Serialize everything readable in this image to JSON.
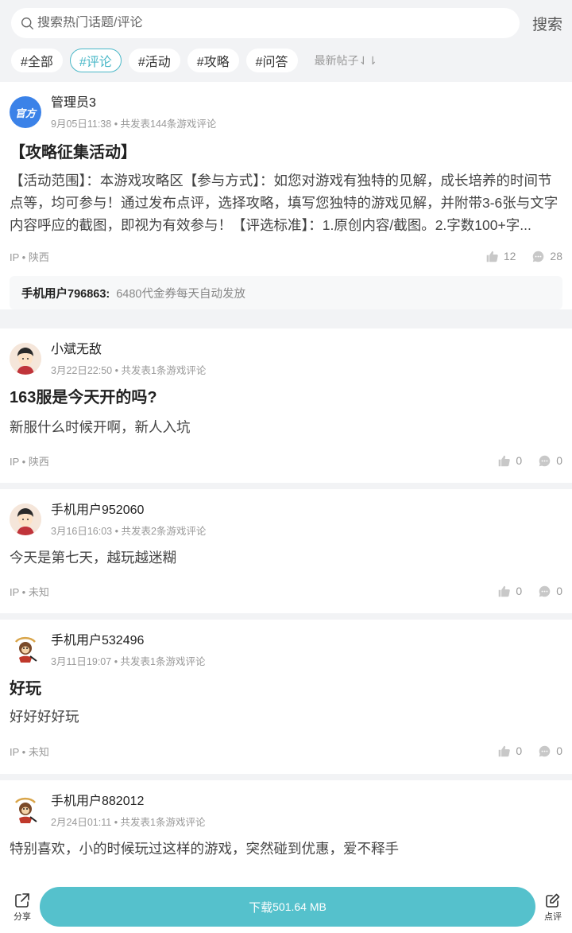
{
  "search": {
    "placeholder": "搜索热门话题/评论",
    "button": "搜索"
  },
  "tabs": [
    {
      "label": "#全部",
      "active": false
    },
    {
      "label": "#评论",
      "active": true
    },
    {
      "label": "#活动",
      "active": false
    },
    {
      "label": "#攻略",
      "active": false
    },
    {
      "label": "#问答",
      "active": false
    }
  ],
  "sort_label": "最新帖子⇃⇂",
  "posts": [
    {
      "user": "管理员3",
      "avatar_text": "官方",
      "time": "9月05日11:38",
      "count_text": "共发表144条游戏评论",
      "title": "【攻略征集活动】",
      "body": "【活动范围】：本游戏攻略区【参与方式】：如您对游戏有独特的见解，成长培养的时间节点等，均可参与！通过发布点评，选择攻略，填写您独特的游戏见解，并附带3-6张与文字内容呼应的截图，即视为有效参与！【评选标准】：1.原创内容/截图。2.字数100+字...",
      "ip": "IP • 陕西",
      "likes": "12",
      "comments": "28",
      "reply_user": "手机用户796863:",
      "reply_text": "6480代金券每天自动发放"
    },
    {
      "user": "小斌无敌",
      "time": "3月22日22:50",
      "count_text": "共发表1条游戏评论",
      "title": "163服是今天开的吗?",
      "body": "新服什么时候开啊，新人入坑",
      "ip": "IP • 陕西",
      "likes": "0",
      "comments": "0"
    },
    {
      "user": "手机用户952060",
      "time": "3月16日16:03",
      "count_text": "共发表2条游戏评论",
      "body": "今天是第七天，越玩越迷糊",
      "ip": "IP • 未知",
      "likes": "0",
      "comments": "0"
    },
    {
      "user": "手机用户532496",
      "time": "3月11日19:07",
      "count_text": "共发表1条游戏评论",
      "title": "好玩",
      "body": "好好好好玩",
      "ip": "IP • 未知",
      "likes": "0",
      "comments": "0"
    },
    {
      "user": "手机用户882012",
      "time": "2月24日01:11",
      "count_text": "共发表1条游戏评论",
      "body": "特别喜欢，小的时候玩过这样的游戏，突然碰到优惠，爱不释手"
    }
  ],
  "bottom": {
    "share": "分享",
    "download": "下载",
    "size": "501.64 MB",
    "review": "点评"
  },
  "colors": {
    "accent": "#55c1cc",
    "tab_active": "#4ab8c8"
  },
  "icons": [
    "search-icon",
    "thumb-up-icon",
    "comment-icon",
    "share-icon",
    "edit-icon"
  ]
}
